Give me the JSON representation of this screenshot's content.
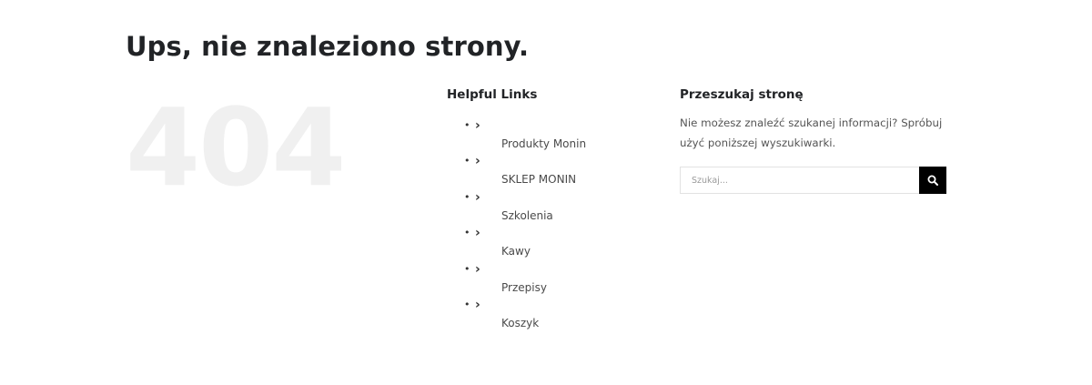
{
  "page": {
    "title": "Ups, nie znaleziono strony.",
    "error_code": "404"
  },
  "helpful_links": {
    "heading": "Helpful Links",
    "items": [
      {
        "label": "Produkty Monin",
        "icon": "chevron-right-icon"
      },
      {
        "label": "SKLEP MONIN",
        "icon": "chevron-right-icon"
      },
      {
        "label": "Szkolenia",
        "icon": "chevron-right-icon"
      },
      {
        "label": "Kawy",
        "icon": "chevron-right-icon"
      },
      {
        "label": "Przepisy",
        "icon": "chevron-right-icon"
      },
      {
        "label": "Koszyk",
        "icon": "chevron-right-icon"
      }
    ]
  },
  "search": {
    "heading": "Przeszukaj stronę",
    "description": "Nie możesz znaleźć szukanej informacji? Spróbuj użyć poniższej wyszukiwarki.",
    "placeholder": "Szukaj...",
    "value": "",
    "button_icon": "search-icon"
  },
  "colors": {
    "title": "#212326",
    "error_code": "#f0f0f0",
    "search_button": "#000000",
    "text": "#4a4a4a"
  }
}
